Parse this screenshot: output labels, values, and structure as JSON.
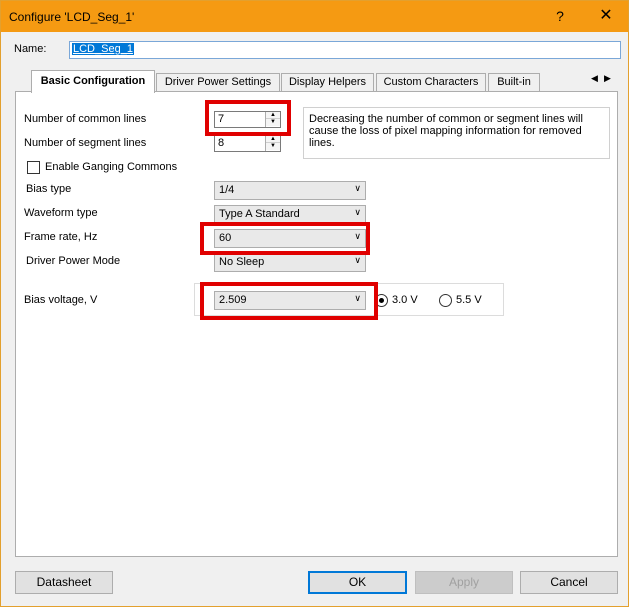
{
  "window": {
    "title": "Configure 'LCD_Seg_1'",
    "help_glyph": "?",
    "close_glyph": "✕"
  },
  "name_field": {
    "label": "Name:",
    "value": "LCD_Seg_1"
  },
  "tabs": [
    {
      "label": "Basic Configuration",
      "active": true
    },
    {
      "label": "Driver Power Settings",
      "active": false
    },
    {
      "label": "Display Helpers",
      "active": false
    },
    {
      "label": "Custom Characters",
      "active": false
    },
    {
      "label": "Built-in",
      "active": false
    }
  ],
  "tab_scroll": {
    "left": "◀",
    "right": "▶"
  },
  "basic": {
    "common_lines": {
      "label": "Number of common lines",
      "value": "7"
    },
    "segment_lines": {
      "label": "Number of segment lines",
      "value": "8"
    },
    "info_text": "Decreasing the number of common or segment lines will cause the loss of pixel mapping information for removed lines.",
    "ganging": {
      "label": "Enable Ganging Commons",
      "checked": false
    },
    "bias_type": {
      "label": "Bias type",
      "value": "1/4"
    },
    "waveform_type": {
      "label": "Waveform type",
      "value": "Type A Standard"
    },
    "frame_rate": {
      "label": "Frame rate, Hz",
      "value": "60"
    },
    "driver_power_mode": {
      "label": "Driver Power Mode",
      "value": "No Sleep"
    },
    "bias_voltage": {
      "label": "Bias voltage, V",
      "value": "2.509",
      "radios": [
        {
          "label": "3.0 V",
          "checked": true
        },
        {
          "label": "5.5 V",
          "checked": false
        }
      ]
    }
  },
  "buttons": {
    "datasheet": "Datasheet",
    "ok": "OK",
    "apply": "Apply",
    "cancel": "Cancel"
  },
  "icons": {
    "spin_up": "▲",
    "spin_down": "▼",
    "chevron": "∨"
  },
  "colors": {
    "titlebar": "#f59a12",
    "highlight": "#e00000",
    "accent": "#0078d7"
  }
}
